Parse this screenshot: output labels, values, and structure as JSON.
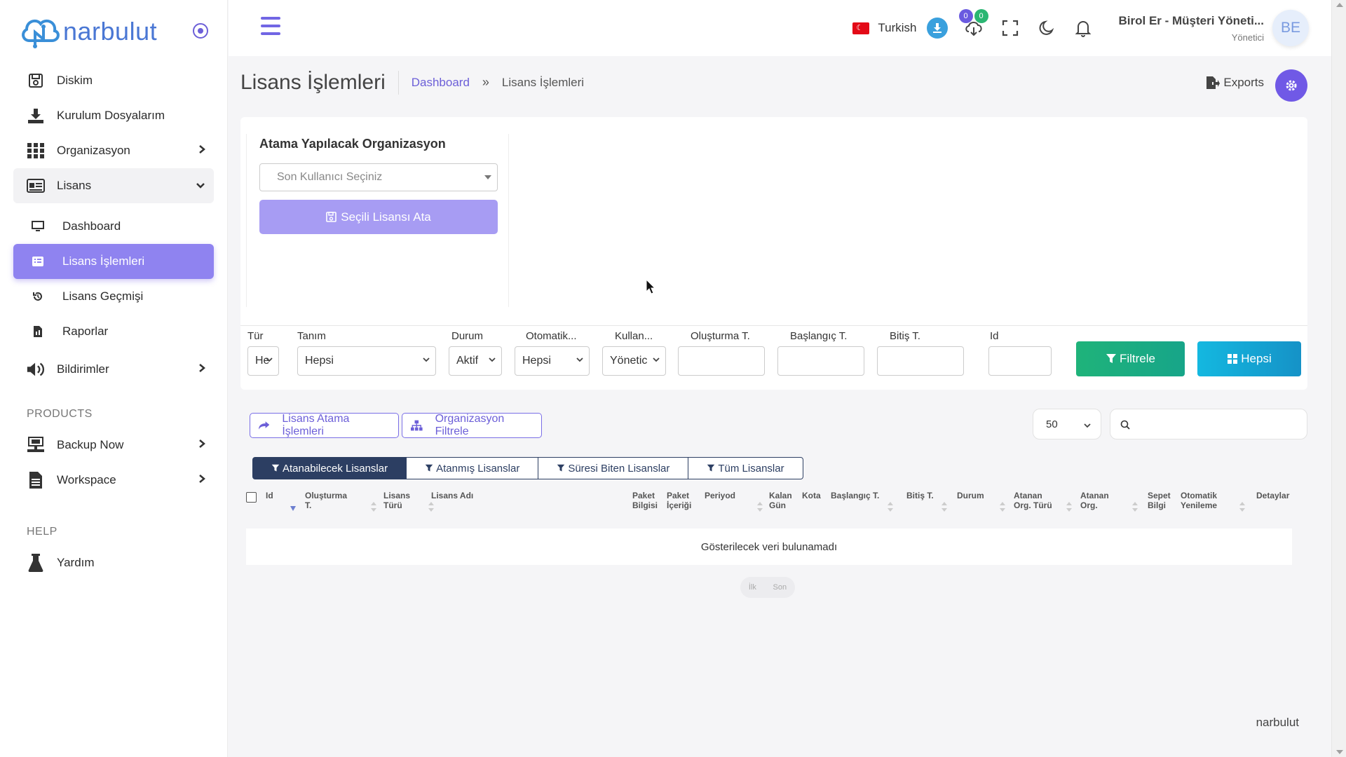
{
  "brand": {
    "logo_text": "narbulut",
    "footer": "narbulut"
  },
  "sidebar": {
    "items": [
      {
        "label": "Diskim",
        "icon": "disk-icon"
      },
      {
        "label": "Kurulum Dosyalarım",
        "icon": "download-icon"
      },
      {
        "label": "Organizasyon",
        "icon": "grid-icon"
      },
      {
        "label": "Lisans",
        "icon": "id-card-icon"
      }
    ],
    "lisans_sub": [
      {
        "label": "Dashboard",
        "icon": "monitor-icon"
      },
      {
        "label": "Lisans İşlemleri",
        "icon": "list-icon"
      },
      {
        "label": "Lisans Geçmişi",
        "icon": "history-icon"
      },
      {
        "label": "Raporlar",
        "icon": "report-icon"
      }
    ],
    "bildirimler": "Bildirimler",
    "products_label": "PRODUCTS",
    "products": [
      {
        "label": "Backup Now",
        "icon": "backup-icon"
      },
      {
        "label": "Workspace",
        "icon": "document-icon"
      }
    ],
    "help_label": "HELP",
    "help": [
      {
        "label": "Yardım",
        "icon": "flask-icon"
      }
    ]
  },
  "topbar": {
    "language": "Turkish",
    "badge_a": "0",
    "badge_b": "0",
    "user_name": "Birol Er - Müşteri Yöneti...",
    "user_role": "Yönetici",
    "avatar": "BE"
  },
  "page": {
    "title": "Lisans İşlemleri",
    "breadcrumb_home": "Dashboard",
    "breadcrumb_sep": "»",
    "breadcrumb_current": "Lisans İşlemleri",
    "exports": "Exports"
  },
  "assign": {
    "title": "Atama Yapılacak Organizasyon",
    "select_placeholder": "Son Kullanıcı Seçiniz",
    "button": "Seçili Lisansı Ata"
  },
  "filters": {
    "tur": {
      "label": "Tür",
      "value": "He"
    },
    "tanim": {
      "label": "Tanım",
      "value": "Hepsi"
    },
    "durum": {
      "label": "Durum",
      "value": "Aktif"
    },
    "otomatik": {
      "label": "Otomatik...",
      "value": "Hepsi"
    },
    "kullan": {
      "label": "Kullan...",
      "value": "Yönetic"
    },
    "olusturma": {
      "label": "Oluşturma T.",
      "value": ""
    },
    "baslangic": {
      "label": "Başlangıç T.",
      "value": ""
    },
    "bitis": {
      "label": "Bitiş T.",
      "value": ""
    },
    "id": {
      "label": "Id",
      "value": ""
    },
    "filtrele": "Filtrele",
    "hepsi": "Hepsi"
  },
  "tools": {
    "lisans_atama": "Lisans Atama İşlemleri",
    "org_filtre": "Organizasyon Filtrele",
    "page_size": "50"
  },
  "tabs": [
    "Atanabilecek Lisanslar",
    "Atanmış Lisanslar",
    "Süresi Biten Lisanslar",
    "Tüm Lisanslar"
  ],
  "table": {
    "columns": [
      "Id",
      "Oluşturma T.",
      "Lisans Türü",
      "Lisans Adı",
      "Paket Bilgisi",
      "Paket İçeriği",
      "Periyod",
      "Kalan Gün",
      "Kota",
      "Başlangıç T.",
      "Bitiş T.",
      "Durum",
      "Atanan Org. Türü",
      "Atanan Org.",
      "Sepet Bilgi",
      "Otomatik Yenileme",
      "Detaylar"
    ],
    "empty": "Gösterilecek veri bulunamadı"
  },
  "pager": {
    "first": "İlk",
    "last": "Son"
  },
  "colors": {
    "accent": "#7059e6",
    "active_nav": "#8f83f0",
    "filter_green": "#1fb37a",
    "filter_blue": "#14a3d9",
    "tab_dark": "#2c3e62"
  }
}
